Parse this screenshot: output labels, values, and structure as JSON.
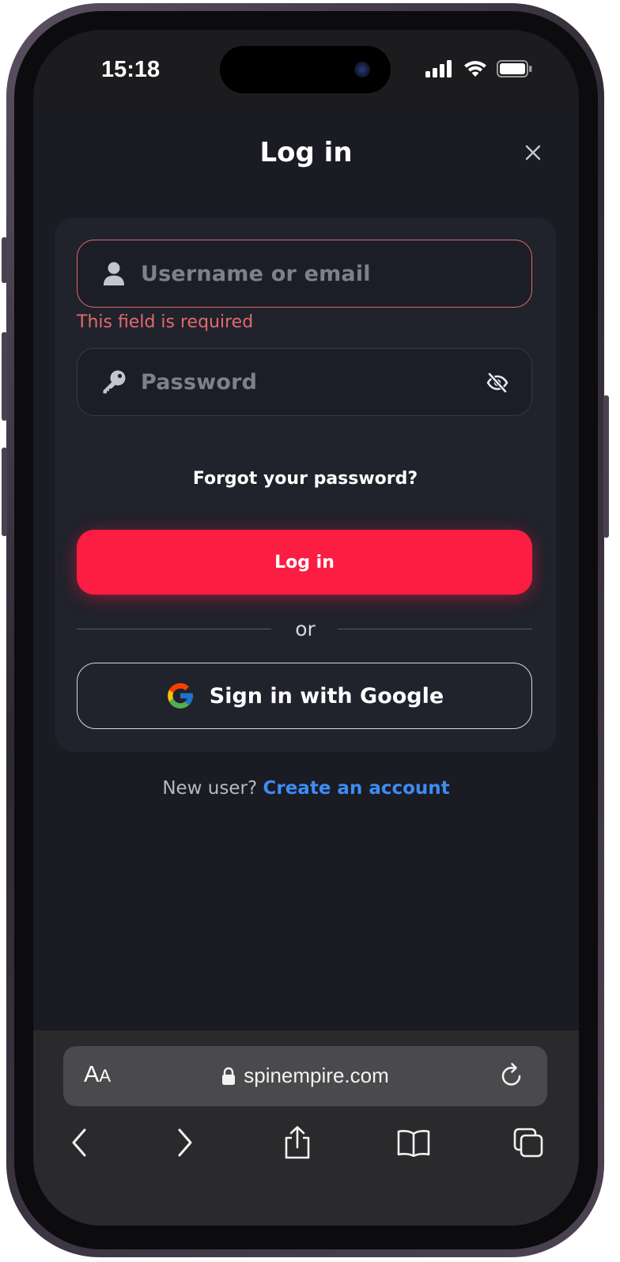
{
  "status_bar": {
    "time": "15:18"
  },
  "modal": {
    "title": "Log in",
    "username_placeholder": "Username or email",
    "username_error": "This field is required",
    "password_placeholder": "Password",
    "forgot_label": "Forgot your password?",
    "login_label": "Log in",
    "divider_label": "or",
    "google_label": "Sign in with Google"
  },
  "signup": {
    "question": "New user?",
    "link_label": "Create an account"
  },
  "browser": {
    "text_size_label": "AA",
    "url": "spinempire.com"
  },
  "icons": {
    "close": "close-icon",
    "user": "user-icon",
    "key": "key-icon",
    "eye_off": "eye-off-icon",
    "google": "google-logo-icon",
    "lock": "lock-icon",
    "reload": "reload-icon",
    "back": "chevron-left-icon",
    "forward": "chevron-right-icon",
    "share": "share-icon",
    "bookmarks": "book-icon",
    "tabs": "tabs-icon"
  },
  "colors": {
    "background": "#1a1b23",
    "card": "#20222c",
    "error": "#e46a6a",
    "primary_button": "#fb1d42",
    "link": "#3d8cf4"
  }
}
